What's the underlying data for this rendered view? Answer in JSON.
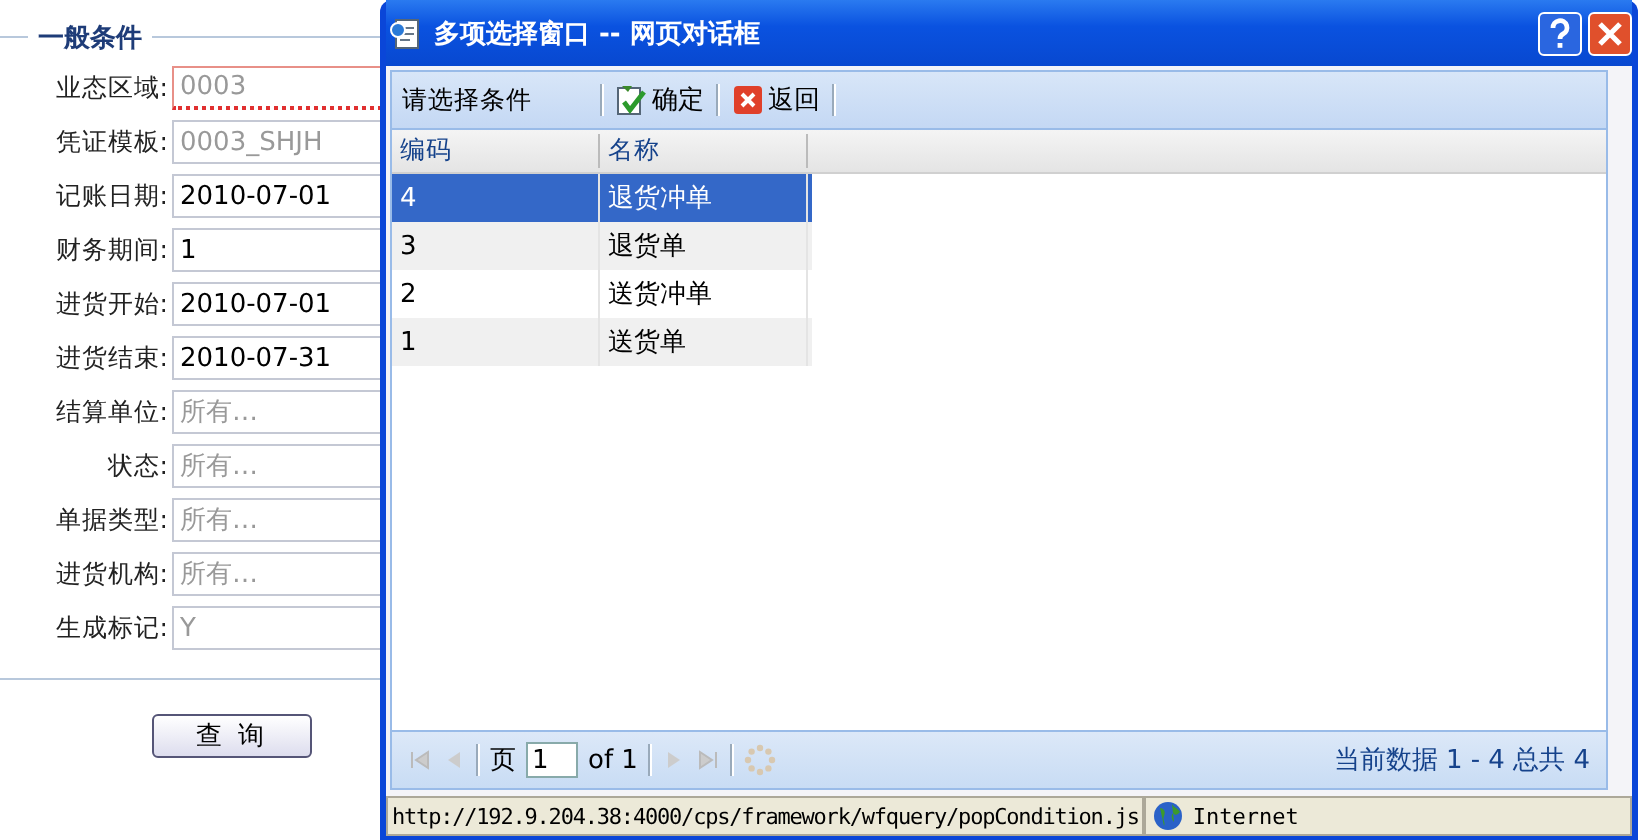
{
  "form": {
    "legend": "一般条件",
    "fields": [
      {
        "label": "业态区域:",
        "value": "0003",
        "disabled": true,
        "invalid": true
      },
      {
        "label": "凭证模板:",
        "value": "0003_SHJH",
        "disabled": true,
        "invalid": false
      },
      {
        "label": "记账日期:",
        "value": "2010-07-01",
        "disabled": false,
        "invalid": false
      },
      {
        "label": "财务期间:",
        "value": "1",
        "disabled": false,
        "invalid": false
      },
      {
        "label": "进货开始:",
        "value": "2010-07-01",
        "disabled": false,
        "invalid": false
      },
      {
        "label": "进货结束:",
        "value": "2010-07-31",
        "disabled": false,
        "invalid": false
      },
      {
        "label": "结算单位:",
        "placeholder": "所有…",
        "invalid": false
      },
      {
        "label": "状态:",
        "placeholder": "所有…",
        "invalid": false
      },
      {
        "label": "单据类型:",
        "placeholder": "所有…",
        "invalid": false
      },
      {
        "label": "进货机构:",
        "placeholder": "所有…",
        "invalid": false
      },
      {
        "label": "生成标记:",
        "value": "Y",
        "disabled": true,
        "invalid": false
      }
    ],
    "button": "查 询"
  },
  "dialog": {
    "title": "多项选择窗口 -- 网页对话框",
    "toolbar": {
      "label": "请选择条件",
      "buttons": [
        {
          "kind": "ok",
          "label": "确定"
        },
        {
          "kind": "back",
          "label": "返回"
        }
      ]
    },
    "table": {
      "columns": [
        "编码",
        "名称"
      ],
      "rows": [
        {
          "cells": [
            "4",
            "退货冲单"
          ],
          "selected": true
        },
        {
          "cells": [
            "3",
            "退货单"
          ],
          "selected": false
        },
        {
          "cells": [
            "2",
            "送货冲单"
          ],
          "selected": false
        },
        {
          "cells": [
            "1",
            "送货单"
          ],
          "selected": false
        }
      ]
    },
    "pager": {
      "page_label": "页",
      "page": "1",
      "of": "of 1",
      "summary": "当前数据 1 - 4 总共 4"
    },
    "status_bar": {
      "url": "http://192.9.204.38:4000/cps/framework/wfquery/popCondition.js",
      "zone": "Internet"
    }
  }
}
